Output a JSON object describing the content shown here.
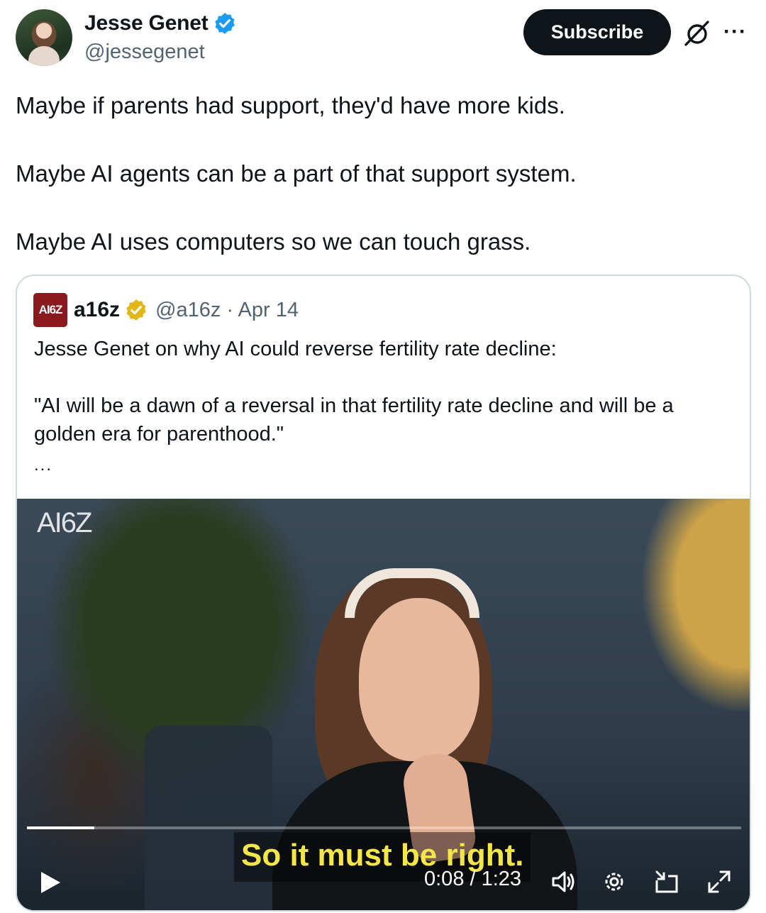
{
  "author": {
    "display_name": "Jesse Genet",
    "handle": "@jessegenet",
    "verified_icon": "blue-verified-badge-icon"
  },
  "actions": {
    "subscribe_label": "Subscribe",
    "grok_icon": "grok-icon",
    "more_icon": "more-horizontal-icon",
    "more_glyph": "···"
  },
  "tweet": {
    "paragraphs": [
      "Maybe if parents had support, they'd have more kids.",
      "Maybe AI agents can be a part of that support system.",
      "Maybe AI uses computers so we can touch grass."
    ]
  },
  "quoted_tweet": {
    "logo_text": "AI6Z",
    "display_name": "a16z",
    "verified_icon": "gold-verified-badge-icon",
    "handle_date": "@a16z · Apr 14",
    "paragraphs": [
      "Jesse Genet on why AI could reverse fertility rate decline:",
      "\"AI will be a dawn of a reversal in that fertility rate decline and will be a golden era for parenthood.\""
    ],
    "ellipsis": "..."
  },
  "video": {
    "watermark": "AI6Z",
    "caption": "So it must be right.",
    "time": "0:08 / 1:23",
    "progress": 0.094,
    "controls": [
      "play-icon",
      "volume-icon",
      "settings-icon",
      "picture-in-picture-icon",
      "fullscreen-icon"
    ]
  },
  "colors": {
    "primary_text": "#0f1419",
    "secondary_text": "#536471",
    "verified_blue": "#1d9bf0",
    "verified_gold": "#e2b719",
    "a16z_brand": "#8b1a1f",
    "caption_yellow": "#f2e64a"
  }
}
